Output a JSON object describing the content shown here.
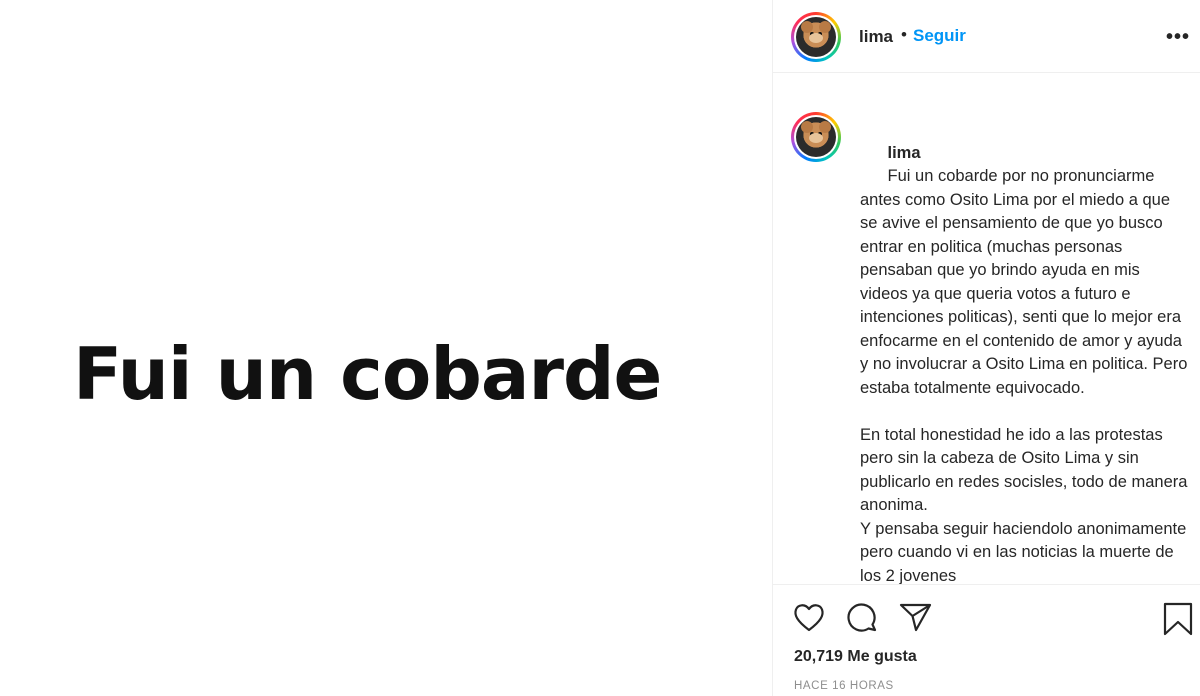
{
  "post": {
    "image_text": "Fui un cobarde"
  },
  "header": {
    "username": "lima",
    "separator": "•",
    "follow_label": "Seguir",
    "more_label": "•••"
  },
  "caption": {
    "username": "lima",
    "paragraphs": [
      "Fui un cobarde por no pronunciarme antes como Osito Lima por el miedo a que se avive el pensamiento de que yo busco entrar en politica (muchas personas pensaban que yo brindo ayuda en mis videos ya que queria votos a futuro e intenciones politicas), senti que lo mejor era enfocarme en el contenido de amor y ayuda y no involucrar a Osito Lima en politica. Pero estaba totalmente equivocado.",
      "En total honestidad he ido a las protestas pero sin la cabeza de Osito Lima y sin publicarlo en redes socisles, todo de manera anonima.\nY pensaba seguir haciendolo anonimamente pero cuando vi en las noticias la muerte de los 2 jovenes"
    ]
  },
  "actions": {
    "like_icon": "heart-outline-icon",
    "comment_icon": "comment-bubble-icon",
    "share_icon": "paper-plane-icon",
    "save_icon": "bookmark-icon"
  },
  "likes": {
    "count": "20,719",
    "label": "Me gusta"
  },
  "timestamp": "HACE 16 HORAS",
  "colors": {
    "follow_blue": "#0095f6",
    "text": "#262626",
    "muted": "#8e8e8e",
    "border": "#efefef"
  }
}
